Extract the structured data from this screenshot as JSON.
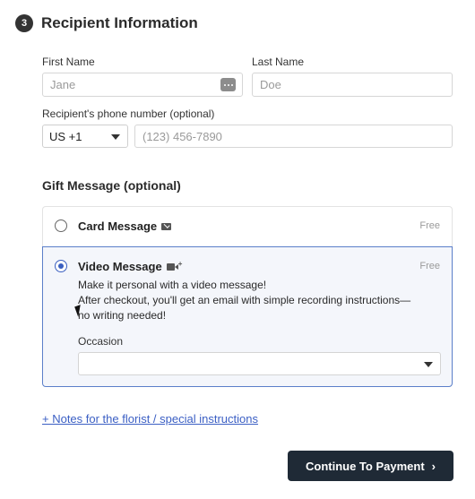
{
  "section": {
    "step": "3",
    "title": "Recipient Information"
  },
  "recipient": {
    "first_name_label": "First Name",
    "first_name_placeholder": "Jane",
    "last_name_label": "Last Name",
    "last_name_placeholder": "Doe",
    "phone_label": "Recipient's phone number (optional)",
    "country_code": "US +1",
    "phone_placeholder": "(123) 456-7890"
  },
  "gift": {
    "title": "Gift Message (optional)",
    "selected": "video",
    "card": {
      "label": "Card Message",
      "price": "Free",
      "icon": "envelope-icon"
    },
    "video": {
      "label": "Video Message",
      "price": "Free",
      "icon": "video-camera-icon",
      "desc_lines": [
        "Make it personal with a video message!",
        "After checkout, you'll get an email with simple recording instructions—",
        "no writing needed!"
      ],
      "occasion_label": "Occasion",
      "occasion_value": ""
    }
  },
  "notes_link": "+ Notes for the florist / special instructions",
  "continue_button": "Continue To Payment",
  "continue_icon": "chevron-right-icon",
  "colors": {
    "accent": "#3a5fc0",
    "button": "#1f2a36",
    "link": "#3b5fc4"
  }
}
